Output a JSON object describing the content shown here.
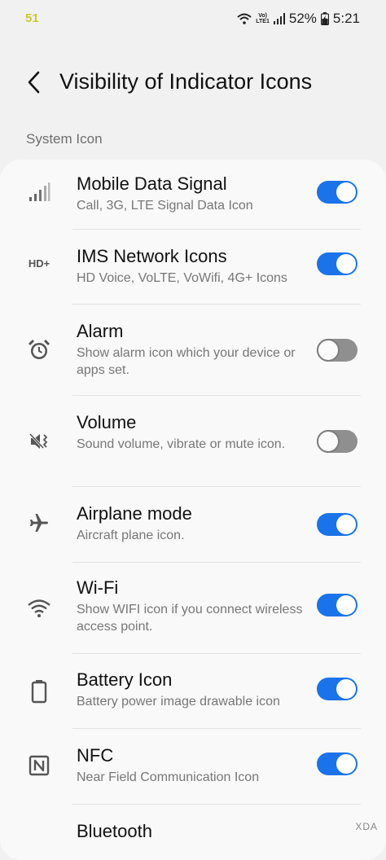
{
  "status_bar": {
    "left_text": "51",
    "lte_top": "Vo)",
    "lte_bottom": "LTE1",
    "battery": "52%",
    "time": "5:21"
  },
  "header": {
    "title": "Visibility of Indicator Icons"
  },
  "section": {
    "title": "System Icon"
  },
  "items": [
    {
      "title": "Mobile Data Signal",
      "subtitle": "Call, 3G, LTE Signal Data Icon",
      "icon": "signal-bars-icon",
      "enabled": true
    },
    {
      "title": "IMS Network Icons",
      "subtitle": "HD Voice, VoLTE, VoWifi, 4G+ Icons",
      "icon": "hd-plus-icon",
      "icon_text": "HD+",
      "enabled": true
    },
    {
      "title": "Alarm",
      "subtitle": "Show alarm icon which your device or apps set.",
      "icon": "alarm-clock-icon",
      "enabled": false
    },
    {
      "title": "Volume",
      "subtitle": "Sound volume, vibrate or mute icon.",
      "icon": "mute-vibrate-icon",
      "enabled": false
    },
    {
      "title": "Airplane mode",
      "subtitle": "Aircraft plane icon.",
      "icon": "airplane-icon",
      "enabled": true
    },
    {
      "title": "Wi-Fi",
      "subtitle": "Show WIFI icon if you connect wireless access point.",
      "icon": "wifi-icon",
      "enabled": true
    },
    {
      "title": "Battery Icon",
      "subtitle": "Battery power image drawable icon",
      "icon": "battery-icon",
      "enabled": true
    },
    {
      "title": "NFC",
      "subtitle": "Near Field Communication Icon",
      "icon": "nfc-icon",
      "enabled": true
    },
    {
      "title": "Bluetooth",
      "subtitle": "",
      "icon": "bluetooth-icon",
      "enabled": true
    }
  ],
  "watermark": "XDA",
  "colors": {
    "accent": "#1a73e8",
    "background": "#f1f1f1",
    "card": "#f9f9f9"
  }
}
